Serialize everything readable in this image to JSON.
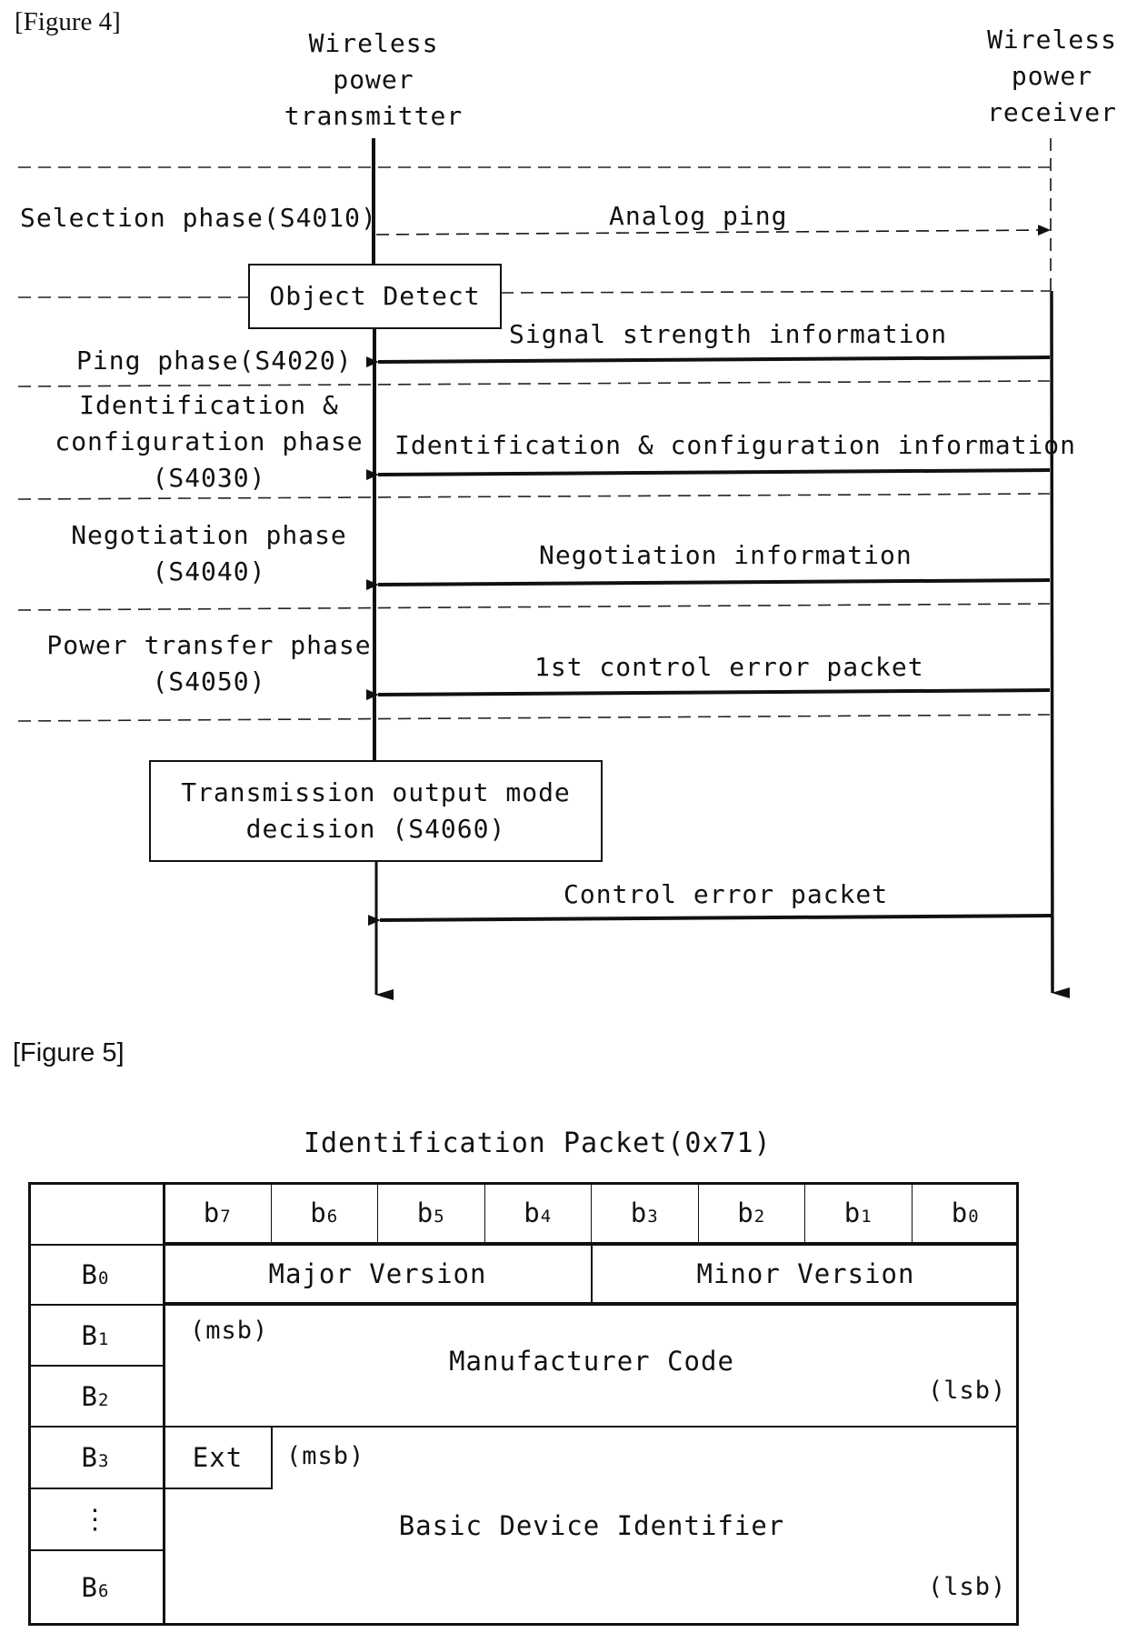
{
  "figure4": {
    "label": "[Figure 4]",
    "transmitter": {
      "line1": "Wireless",
      "line2": "power",
      "line3": "transmitter"
    },
    "receiver": {
      "line1": "Wireless",
      "line2": "power",
      "line3": "receiver"
    },
    "phases": [
      {
        "id": "S4010",
        "lines": [
          "Selection phase(S4010)"
        ]
      },
      {
        "id": "S4020",
        "lines": [
          "Ping phase(S4020)"
        ]
      },
      {
        "id": "S4030",
        "lines": [
          "Identification &",
          "configuration phase",
          "(S4030)"
        ]
      },
      {
        "id": "S4040",
        "lines": [
          "Negotiation phase",
          "(S4040)"
        ]
      },
      {
        "id": "S4050",
        "lines": [
          "Power transfer phase",
          "(S4050)"
        ]
      }
    ],
    "boxes": {
      "object_detect": "Object Detect",
      "tx_mode_decision": [
        "Transmission output mode",
        "decision (S4060)"
      ]
    },
    "messages": [
      {
        "label": "Analog ping",
        "direction": "transmitter-to-receiver",
        "style": "dashed"
      },
      {
        "label": "Signal strength information",
        "direction": "receiver-to-transmitter",
        "style": "solid"
      },
      {
        "label": "Identification & configuration information",
        "direction": "receiver-to-transmitter",
        "style": "solid"
      },
      {
        "label": "Negotiation information",
        "direction": "receiver-to-transmitter",
        "style": "solid"
      },
      {
        "label": "1st control error packet",
        "direction": "receiver-to-transmitter",
        "style": "solid"
      },
      {
        "label": "Control error packet",
        "direction": "receiver-to-transmitter",
        "style": "solid"
      }
    ]
  },
  "figure5": {
    "label": "[Figure 5]",
    "title": "Identification Packet(0x71)",
    "bit_headers": [
      {
        "base": "b",
        "sub": "7"
      },
      {
        "base": "b",
        "sub": "6"
      },
      {
        "base": "b",
        "sub": "5"
      },
      {
        "base": "b",
        "sub": "4"
      },
      {
        "base": "b",
        "sub": "3"
      },
      {
        "base": "b",
        "sub": "2"
      },
      {
        "base": "b",
        "sub": "1"
      },
      {
        "base": "b",
        "sub": "0"
      }
    ],
    "byte_rows": [
      {
        "base": "B",
        "sub": "0"
      },
      {
        "base": "B",
        "sub": "1"
      },
      {
        "base": "B",
        "sub": "2"
      },
      {
        "base": "B",
        "sub": "3"
      },
      {
        "base": "",
        "sub": "",
        "ellipsis": "⋮"
      },
      {
        "base": "B",
        "sub": "6"
      }
    ],
    "fields": {
      "major_version": "Major Version",
      "minor_version": "Minor Version",
      "manufacturer_code": "Manufacturer Code",
      "ext": "Ext",
      "basic_device_identifier": "Basic Device Identifier",
      "msb": "(msb)",
      "lsb": "(lsb)"
    }
  }
}
